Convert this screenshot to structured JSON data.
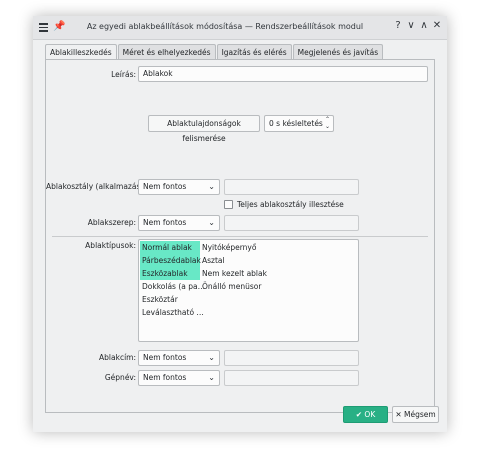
{
  "window": {
    "title": "Az egyedi ablakbeállítások módosítása — Rendszerbeállítások modul",
    "controls": {
      "help": "?",
      "minimize": "∨",
      "maximize": "∧",
      "close": "✕"
    }
  },
  "tabs": [
    {
      "label": "Ablakilleszkedés",
      "active": true
    },
    {
      "label": "Méret és elhelyezkedés",
      "active": false
    },
    {
      "label": "Igazítás és elérés",
      "active": false
    },
    {
      "label": "Megjelenés és javítás",
      "active": false
    }
  ],
  "form": {
    "description_label": "Leírás:",
    "description_value": "Ablakok",
    "detect_button": "Ablaktulajdonságok felismerése",
    "delay_value": "0 s késleltetés",
    "class_label": "Ablakosztály (alkalmazás):",
    "class_combo": "Nem fontos",
    "whole_class_label": "Teljes ablakosztály illesztése",
    "role_label": "Ablakszerep:",
    "role_combo": "Nem fontos",
    "types_label": "Ablaktípusok:",
    "types_col1": [
      {
        "label": "Normál ablak",
        "selected": true
      },
      {
        "label": "Párbeszédablak",
        "selected": true
      },
      {
        "label": "Eszközablak",
        "selected": true
      },
      {
        "label": "Dokkolás (a pa…",
        "selected": false
      },
      {
        "label": "Eszköztár",
        "selected": false
      },
      {
        "label": "Leválasztható …",
        "selected": false
      }
    ],
    "types_col2": [
      {
        "label": "Nyitóképernyő",
        "selected": false
      },
      {
        "label": "Asztal",
        "selected": false
      },
      {
        "label": "Nem kezelt ablak",
        "selected": false
      },
      {
        "label": "Önálló menüsor",
        "selected": false
      }
    ],
    "title_label": "Ablakcím:",
    "title_combo": "Nem fontos",
    "machine_label": "Gépnév:",
    "machine_combo": "Nem fontos"
  },
  "footer": {
    "ok_label": "OK",
    "cancel_label": "Mégsem"
  },
  "colors": {
    "accent": "#28b085",
    "selection": "#68e8c6"
  }
}
